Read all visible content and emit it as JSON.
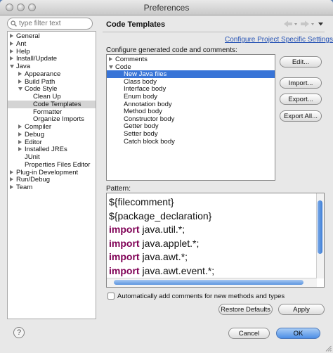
{
  "window": {
    "title": "Preferences"
  },
  "filter": {
    "placeholder": "type filter text"
  },
  "sidebar": {
    "items": [
      {
        "label": "General",
        "level": 0,
        "arrow": "right"
      },
      {
        "label": "Ant",
        "level": 0,
        "arrow": "right"
      },
      {
        "label": "Help",
        "level": 0,
        "arrow": "right"
      },
      {
        "label": "Install/Update",
        "level": 0,
        "arrow": "right"
      },
      {
        "label": "Java",
        "level": 0,
        "arrow": "down"
      },
      {
        "label": "Appearance",
        "level": 1,
        "arrow": "right"
      },
      {
        "label": "Build Path",
        "level": 1,
        "arrow": "right"
      },
      {
        "label": "Code Style",
        "level": 1,
        "arrow": "down"
      },
      {
        "label": "Clean Up",
        "level": 2,
        "arrow": "none"
      },
      {
        "label": "Code Templates",
        "level": 2,
        "arrow": "none",
        "selected": true
      },
      {
        "label": "Formatter",
        "level": 2,
        "arrow": "none"
      },
      {
        "label": "Organize Imports",
        "level": 2,
        "arrow": "none"
      },
      {
        "label": "Compiler",
        "level": 1,
        "arrow": "right"
      },
      {
        "label": "Debug",
        "level": 1,
        "arrow": "right"
      },
      {
        "label": "Editor",
        "level": 1,
        "arrow": "right"
      },
      {
        "label": "Installed JREs",
        "level": 1,
        "arrow": "right"
      },
      {
        "label": "JUnit",
        "level": 1,
        "arrow": "none"
      },
      {
        "label": "Properties Files Editor",
        "level": 1,
        "arrow": "none"
      },
      {
        "label": "Plug-in Development",
        "level": 0,
        "arrow": "right"
      },
      {
        "label": "Run/Debug",
        "level": 0,
        "arrow": "right"
      },
      {
        "label": "Team",
        "level": 0,
        "arrow": "right"
      }
    ]
  },
  "main": {
    "heading": "Code Templates",
    "project_link": "Configure Project Specific Settings...",
    "configure_label": "Configure generated code and comments:",
    "templates": [
      {
        "label": "Comments",
        "level": 0,
        "arrow": "right"
      },
      {
        "label": "Code",
        "level": 0,
        "arrow": "down"
      },
      {
        "label": "New Java files",
        "level": 1,
        "arrow": "none",
        "selected": true
      },
      {
        "label": "Class body",
        "level": 1,
        "arrow": "none"
      },
      {
        "label": "Interface body",
        "level": 1,
        "arrow": "none"
      },
      {
        "label": "Enum body",
        "level": 1,
        "arrow": "none"
      },
      {
        "label": "Annotation body",
        "level": 1,
        "arrow": "none"
      },
      {
        "label": "Method body",
        "level": 1,
        "arrow": "none"
      },
      {
        "label": "Constructor body",
        "level": 1,
        "arrow": "none"
      },
      {
        "label": "Getter body",
        "level": 1,
        "arrow": "none"
      },
      {
        "label": "Setter body",
        "level": 1,
        "arrow": "none"
      },
      {
        "label": "Catch block body",
        "level": 1,
        "arrow": "none"
      }
    ],
    "buttons": {
      "edit": "Edit...",
      "import": "Import...",
      "export": "Export...",
      "export_all": "Export All..."
    },
    "pattern_label": "Pattern:",
    "pattern_lines": [
      {
        "kw": "",
        "text": "${filecomment}"
      },
      {
        "kw": "",
        "text": "${package_declaration}"
      },
      {
        "kw": "import",
        "text": " java.util.*;"
      },
      {
        "kw": "import",
        "text": " java.applet.*;"
      },
      {
        "kw": "import",
        "text": " java.awt.*;"
      },
      {
        "kw": "import",
        "text": " java.awt.event.*;"
      }
    ],
    "auto_comments_label": "Automatically add comments for new methods and types",
    "auto_comments_checked": false,
    "restore_defaults": "Restore Defaults",
    "apply": "Apply"
  },
  "footer": {
    "help": "?",
    "cancel": "Cancel",
    "ok": "OK"
  },
  "colors": {
    "selection": "#3874d7",
    "keyword": "#7f0055",
    "link": "#2552b4",
    "desktop": "#5b7fb3"
  }
}
